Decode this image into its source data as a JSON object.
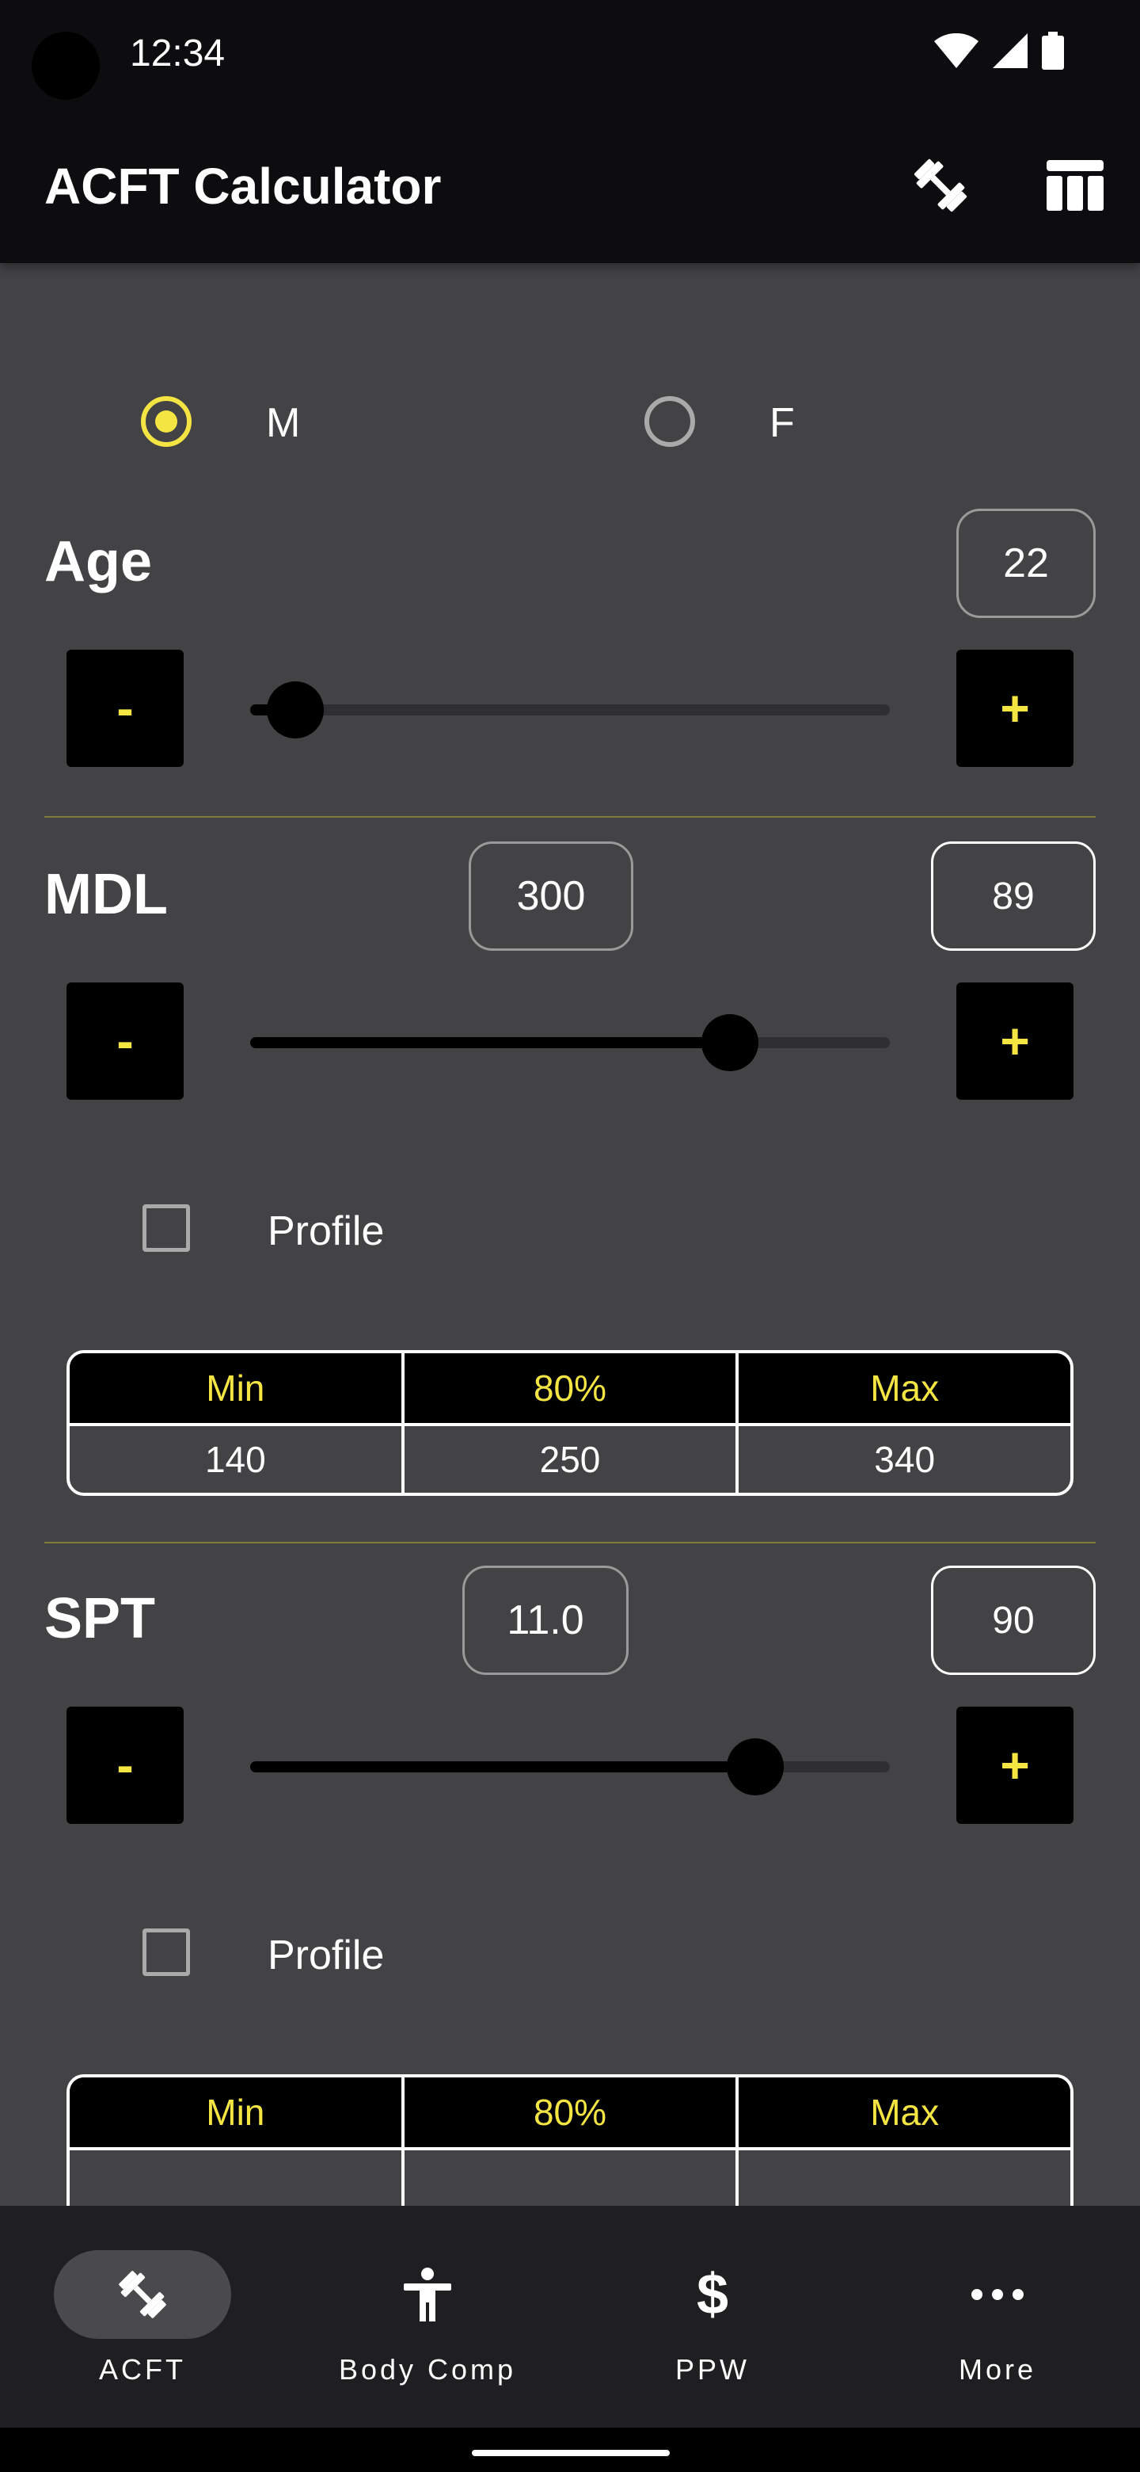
{
  "status_bar": {
    "time": "12:34"
  },
  "app_bar": {
    "title": "ACFT Calculator",
    "actions": [
      "dumbbell-icon",
      "table-icon"
    ]
  },
  "sex": {
    "options": [
      {
        "label": "M",
        "selected": true
      },
      {
        "label": "F",
        "selected": false
      }
    ]
  },
  "age": {
    "title": "Age",
    "value": "22",
    "slider_fraction": 0.07,
    "minus_label": "-",
    "plus_label": "+"
  },
  "mdl": {
    "title": "MDL",
    "raw_value": "300",
    "score": "89",
    "slider_fraction": 0.75,
    "minus_label": "-",
    "plus_label": "+",
    "profile_label": "Profile",
    "table": {
      "headers": [
        "Min",
        "80%",
        "Max"
      ],
      "values": [
        "140",
        "250",
        "340"
      ]
    }
  },
  "spt": {
    "title": "SPT",
    "raw_value": "11.0",
    "score": "90",
    "slider_fraction": 0.79,
    "minus_label": "-",
    "plus_label": "+",
    "profile_label": "Profile",
    "table": {
      "headers": [
        "Min",
        "80%",
        "Max"
      ]
    }
  },
  "bottom_nav": {
    "items": [
      {
        "label": "ACFT",
        "icon": "dumbbell-icon",
        "active": true
      },
      {
        "label": "Body Comp",
        "icon": "person-icon",
        "active": false
      },
      {
        "label": "PPW",
        "icon": "dollar-icon",
        "active": false
      },
      {
        "label": "More",
        "icon": "more-icon",
        "active": false
      }
    ]
  },
  "colors": {
    "accent": "#f4e542",
    "background": "#434345",
    "bar": "#0d0d0f",
    "nav": "#1f1f21"
  }
}
